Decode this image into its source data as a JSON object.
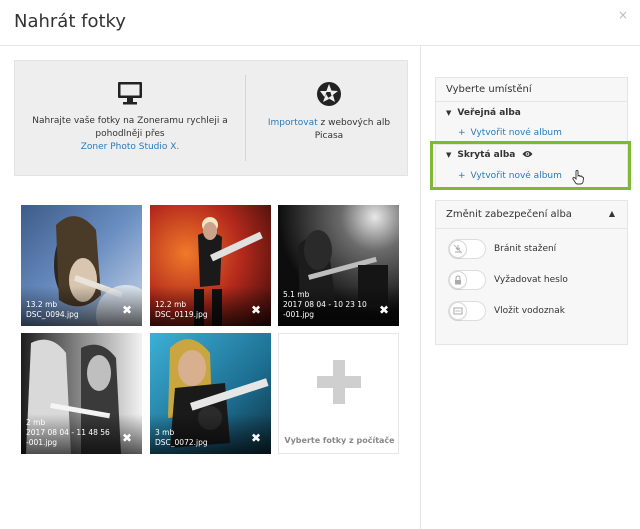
{
  "header": {
    "title": "Nahrát fotky",
    "close": "×"
  },
  "source": {
    "left_text": "Nahrajte vaše fotky na Zoneramu rychleji a pohodlněji přes",
    "left_link": "Zoner Photo Studio X.",
    "right_link": "Importovat",
    "right_text": " z webových alb Picasa",
    "left_icon": "monitor-icon",
    "right_icon": "picasa-icon"
  },
  "photos": [
    {
      "size": "13.2 mb",
      "name": "DSC_0094.jpg"
    },
    {
      "size": "12.2 mb",
      "name": "DSC_0119.jpg"
    },
    {
      "size": "5.1 mb",
      "name": "2017 08 04 - 10 23 10 -001.jpg"
    },
    {
      "size": "2 mb",
      "name": "2017 08 04 - 11 48 56 -001.jpg"
    },
    {
      "size": "3 mb",
      "name": "DSC_0072.jpg"
    }
  ],
  "delete_symbol": "✖",
  "add_tile": {
    "label": "Vyberte fotky z počítače"
  },
  "location": {
    "heading": "Vyberte umístění",
    "groups": [
      {
        "chevron": "▼",
        "label": "Veřejná alba",
        "new_album": "Vytvořit nové album"
      },
      {
        "chevron": "▼",
        "label": "Skrytá alba",
        "icon": "eye-icon",
        "new_album": "Vytvořit nové album"
      }
    ],
    "highlight_color": "#7fb934"
  },
  "security": {
    "heading": "Změnit zabezpečení alba",
    "caret": "▲",
    "options": [
      {
        "label": "Bránit stažení",
        "icon": "no-download-icon",
        "enabled": false
      },
      {
        "label": "Vyžadovat heslo",
        "icon": "lock-icon",
        "enabled": false
      },
      {
        "label": "Vložit vodoznak",
        "icon": "watermark-icon",
        "enabled": false
      }
    ]
  },
  "colors": {
    "link": "#2a7ab8",
    "accent_green": "#7fb934"
  }
}
